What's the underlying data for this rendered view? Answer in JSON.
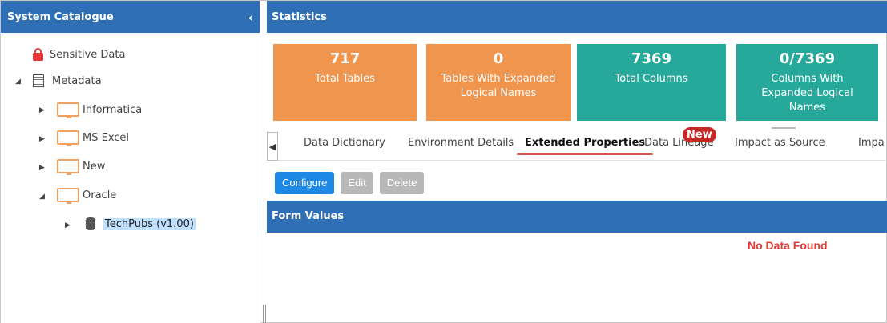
{
  "catalogue": {
    "title": "System Catalogue",
    "collapse_glyph": "‹",
    "tree": [
      {
        "label": "Sensitive Data",
        "icon": "lock-icon"
      },
      {
        "label": "Metadata",
        "icon": "metadata-icon",
        "expanded": true
      },
      {
        "label": "Informatica",
        "icon": "folder-icon"
      },
      {
        "label": "MS Excel",
        "icon": "folder-icon"
      },
      {
        "label": "New",
        "icon": "folder-icon"
      },
      {
        "label": "Oracle",
        "icon": "folder-icon",
        "expanded": true
      },
      {
        "label": "TechPubs (v1.00)",
        "icon": "database-icon",
        "selected": true
      }
    ]
  },
  "statistics": {
    "title": "Statistics",
    "cards": [
      {
        "value": "717",
        "label": "Total Tables",
        "color": "#f0954e"
      },
      {
        "value": "0",
        "label": "Tables With Expanded Logical Names",
        "color": "#f0954e"
      },
      {
        "value": "7369",
        "label": "Total Columns",
        "color": "#26a99a"
      },
      {
        "value": "0/7369",
        "label": "Columns With Expanded Logical Names",
        "color": "#26a99a"
      }
    ]
  },
  "tabs": {
    "items": [
      "Data Dictionary",
      "Environment Details",
      "Extended Properties",
      "Data Lineage",
      "Impact as Source",
      "Impa"
    ],
    "active": "Extended Properties",
    "badge": "New"
  },
  "toolbar": {
    "configure": "Configure",
    "edit": "Edit",
    "delete": "Delete"
  },
  "form": {
    "title": "Form Values",
    "empty_message": "No Data Found"
  },
  "colors": {
    "header_blue": "#2f6fb5",
    "orange": "#f0954e",
    "teal": "#26a99a",
    "accent_red": "#e53935"
  }
}
